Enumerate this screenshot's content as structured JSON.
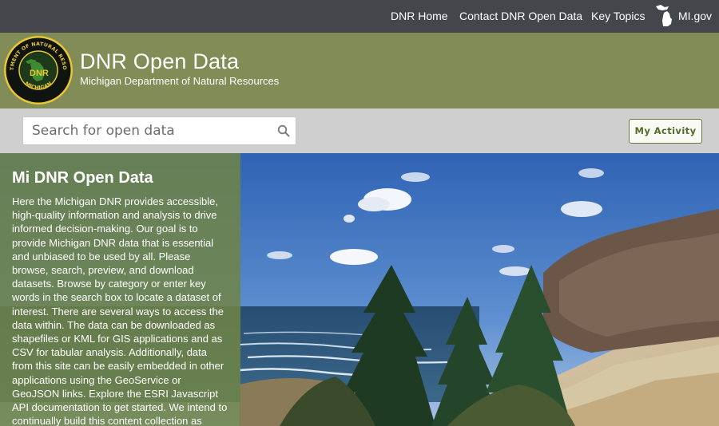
{
  "topnav": {
    "links": [
      "DNR Home",
      "Contact DNR Open Data",
      "Key Topics"
    ],
    "state_link": "MI.gov",
    "state_icon": "michigan-icon"
  },
  "header": {
    "seal_text_top": "DEPARTMENT OF NATURAL RESOURCES",
    "seal_text_center": "DNR",
    "seal_text_bottom": "MICHIGAN",
    "title": "DNR Open Data",
    "subtitle": "Michigan Department of Natural Resources"
  },
  "search": {
    "placeholder": "Search for open data",
    "icon": "search-icon",
    "activity_label": "My Activity"
  },
  "intro": {
    "title": "Mi DNR Open Data",
    "body": "Here the Michigan DNR provides accessible, high-quality information and analysis to drive informed decision-making. Our goal is to provide Michigan DNR data that is essential and unbiased to be used by all. Please browse, search, preview, and download datasets. Browse by category or enter key words in the search box to locate a dataset of interest. There are several ways to access the data within. The data can be downloaded as shapefiles or KML for GIS applications and as CSV for tabular analysis. Additionally, data from this site can be easily embedded in other applications using the GeoService or GeoJSON links. Explore the ESRI Javascript API documentation to get started. We intend to continually build this content collection as"
  },
  "colors": {
    "topnav_bg": "#45464c",
    "header_bg": "#828c56",
    "search_band_bg": "#cfcfcf",
    "accent_green": "#55692b",
    "panel_overlay": "#708446"
  }
}
